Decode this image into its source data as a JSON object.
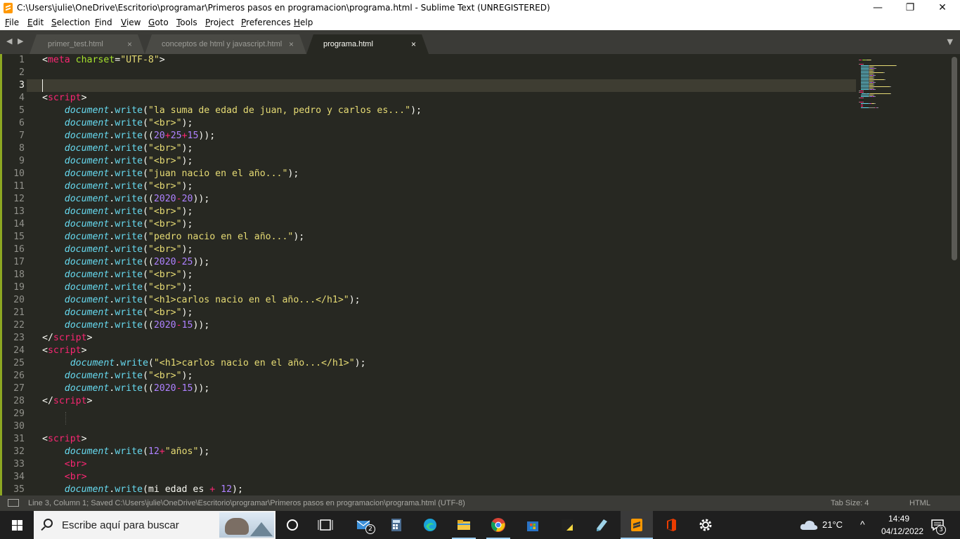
{
  "window": {
    "title": "C:\\Users\\julie\\OneDrive\\Escritorio\\programar\\Primeros pasos en programacion\\programa.html - Sublime Text (UNREGISTERED)",
    "minimize": "—",
    "maximize": "❐",
    "close": "✕"
  },
  "menu": [
    "File",
    "Edit",
    "Selection",
    "Find",
    "View",
    "Goto",
    "Tools",
    "Project",
    "Preferences",
    "Help"
  ],
  "tabs": [
    {
      "label": "primer_test.html",
      "close": "×",
      "active": false
    },
    {
      "label": "conceptos de html y javascript.html",
      "close": "×",
      "active": false
    },
    {
      "label": "programa.html",
      "close": "×",
      "active": true
    }
  ],
  "tabbar": {
    "nav": "◀ ▶",
    "dropdown": "▼"
  },
  "editor": {
    "current_line": 3,
    "lines": [
      [
        [
          "t-punc",
          "<"
        ],
        [
          "t-tag",
          "meta"
        ],
        [
          "t-punc",
          " "
        ],
        [
          "t-attr",
          "charset"
        ],
        [
          "t-punc",
          "="
        ],
        [
          "t-str",
          "\"UTF-8\""
        ],
        [
          "t-punc",
          ">"
        ]
      ],
      [],
      [],
      [
        [
          "t-punc",
          "<"
        ],
        [
          "t-tag",
          "script"
        ],
        [
          "t-punc",
          ">"
        ]
      ],
      [
        [
          "t-punc",
          "    "
        ],
        [
          "t-obj",
          "document"
        ],
        [
          "t-punc",
          "."
        ],
        [
          "t-fn",
          "write"
        ],
        [
          "t-punc",
          "("
        ],
        [
          "t-str",
          "\"la suma de edad de juan, pedro y carlos es...\""
        ],
        [
          "t-punc",
          ");"
        ]
      ],
      [
        [
          "t-punc",
          "    "
        ],
        [
          "t-obj",
          "document"
        ],
        [
          "t-punc",
          "."
        ],
        [
          "t-fn",
          "write"
        ],
        [
          "t-punc",
          "("
        ],
        [
          "t-str",
          "\"<br>\""
        ],
        [
          "t-punc",
          ");"
        ]
      ],
      [
        [
          "t-punc",
          "    "
        ],
        [
          "t-obj",
          "document"
        ],
        [
          "t-punc",
          "."
        ],
        [
          "t-fn",
          "write"
        ],
        [
          "t-punc",
          "(("
        ],
        [
          "t-num",
          "20"
        ],
        [
          "t-op",
          "+"
        ],
        [
          "t-num",
          "25"
        ],
        [
          "t-op",
          "+"
        ],
        [
          "t-num",
          "15"
        ],
        [
          "t-punc",
          "));"
        ]
      ],
      [
        [
          "t-punc",
          "    "
        ],
        [
          "t-obj",
          "document"
        ],
        [
          "t-punc",
          "."
        ],
        [
          "t-fn",
          "write"
        ],
        [
          "t-punc",
          "("
        ],
        [
          "t-str",
          "\"<br>\""
        ],
        [
          "t-punc",
          ");"
        ]
      ],
      [
        [
          "t-punc",
          "    "
        ],
        [
          "t-obj",
          "document"
        ],
        [
          "t-punc",
          "."
        ],
        [
          "t-fn",
          "write"
        ],
        [
          "t-punc",
          "("
        ],
        [
          "t-str",
          "\"<br>\""
        ],
        [
          "t-punc",
          ");"
        ]
      ],
      [
        [
          "t-punc",
          "    "
        ],
        [
          "t-obj",
          "document"
        ],
        [
          "t-punc",
          "."
        ],
        [
          "t-fn",
          "write"
        ],
        [
          "t-punc",
          "("
        ],
        [
          "t-str",
          "\"juan nacio en el año...\""
        ],
        [
          "t-punc",
          ");"
        ]
      ],
      [
        [
          "t-punc",
          "    "
        ],
        [
          "t-obj",
          "document"
        ],
        [
          "t-punc",
          "."
        ],
        [
          "t-fn",
          "write"
        ],
        [
          "t-punc",
          "("
        ],
        [
          "t-str",
          "\"<br>\""
        ],
        [
          "t-punc",
          ");"
        ]
      ],
      [
        [
          "t-punc",
          "    "
        ],
        [
          "t-obj",
          "document"
        ],
        [
          "t-punc",
          "."
        ],
        [
          "t-fn",
          "write"
        ],
        [
          "t-punc",
          "(("
        ],
        [
          "t-num",
          "2020"
        ],
        [
          "t-op",
          "-"
        ],
        [
          "t-num",
          "20"
        ],
        [
          "t-punc",
          "));"
        ]
      ],
      [
        [
          "t-punc",
          "    "
        ],
        [
          "t-obj",
          "document"
        ],
        [
          "t-punc",
          "."
        ],
        [
          "t-fn",
          "write"
        ],
        [
          "t-punc",
          "("
        ],
        [
          "t-str",
          "\"<br>\""
        ],
        [
          "t-punc",
          ");"
        ]
      ],
      [
        [
          "t-punc",
          "    "
        ],
        [
          "t-obj",
          "document"
        ],
        [
          "t-punc",
          "."
        ],
        [
          "t-fn",
          "write"
        ],
        [
          "t-punc",
          "("
        ],
        [
          "t-str",
          "\"<br>\""
        ],
        [
          "t-punc",
          ");"
        ]
      ],
      [
        [
          "t-punc",
          "    "
        ],
        [
          "t-obj",
          "document"
        ],
        [
          "t-punc",
          "."
        ],
        [
          "t-fn",
          "write"
        ],
        [
          "t-punc",
          "("
        ],
        [
          "t-str",
          "\"pedro nacio en el año...\""
        ],
        [
          "t-punc",
          ");"
        ]
      ],
      [
        [
          "t-punc",
          "    "
        ],
        [
          "t-obj",
          "document"
        ],
        [
          "t-punc",
          "."
        ],
        [
          "t-fn",
          "write"
        ],
        [
          "t-punc",
          "("
        ],
        [
          "t-str",
          "\"<br>\""
        ],
        [
          "t-punc",
          ");"
        ]
      ],
      [
        [
          "t-punc",
          "    "
        ],
        [
          "t-obj",
          "document"
        ],
        [
          "t-punc",
          "."
        ],
        [
          "t-fn",
          "write"
        ],
        [
          "t-punc",
          "(("
        ],
        [
          "t-num",
          "2020"
        ],
        [
          "t-op",
          "-"
        ],
        [
          "t-num",
          "25"
        ],
        [
          "t-punc",
          "));"
        ]
      ],
      [
        [
          "t-punc",
          "    "
        ],
        [
          "t-obj",
          "document"
        ],
        [
          "t-punc",
          "."
        ],
        [
          "t-fn",
          "write"
        ],
        [
          "t-punc",
          "("
        ],
        [
          "t-str",
          "\"<br>\""
        ],
        [
          "t-punc",
          ");"
        ]
      ],
      [
        [
          "t-punc",
          "    "
        ],
        [
          "t-obj",
          "document"
        ],
        [
          "t-punc",
          "."
        ],
        [
          "t-fn",
          "write"
        ],
        [
          "t-punc",
          "("
        ],
        [
          "t-str",
          "\"<br>\""
        ],
        [
          "t-punc",
          ");"
        ]
      ],
      [
        [
          "t-punc",
          "    "
        ],
        [
          "t-obj",
          "document"
        ],
        [
          "t-punc",
          "."
        ],
        [
          "t-fn",
          "write"
        ],
        [
          "t-punc",
          "("
        ],
        [
          "t-str",
          "\"<h1>carlos nacio en el año...</h1>\""
        ],
        [
          "t-punc",
          ");"
        ]
      ],
      [
        [
          "t-punc",
          "    "
        ],
        [
          "t-obj",
          "document"
        ],
        [
          "t-punc",
          "."
        ],
        [
          "t-fn",
          "write"
        ],
        [
          "t-punc",
          "("
        ],
        [
          "t-str",
          "\"<br>\""
        ],
        [
          "t-punc",
          ");"
        ]
      ],
      [
        [
          "t-punc",
          "    "
        ],
        [
          "t-obj",
          "document"
        ],
        [
          "t-punc",
          "."
        ],
        [
          "t-fn",
          "write"
        ],
        [
          "t-punc",
          "(("
        ],
        [
          "t-num",
          "2020"
        ],
        [
          "t-op",
          "-"
        ],
        [
          "t-num",
          "15"
        ],
        [
          "t-punc",
          "));"
        ]
      ],
      [
        [
          "t-punc",
          "</"
        ],
        [
          "t-tag",
          "script"
        ],
        [
          "t-punc",
          ">"
        ]
      ],
      [
        [
          "t-punc",
          "<"
        ],
        [
          "t-tag",
          "script"
        ],
        [
          "t-punc",
          ">"
        ]
      ],
      [
        [
          "t-punc",
          "     "
        ],
        [
          "t-obj",
          "document"
        ],
        [
          "t-punc",
          "."
        ],
        [
          "t-fn",
          "write"
        ],
        [
          "t-punc",
          "("
        ],
        [
          "t-str",
          "\"<h1>carlos nacio en el año...</h1>\""
        ],
        [
          "t-punc",
          ");"
        ]
      ],
      [
        [
          "t-punc",
          "    "
        ],
        [
          "t-obj",
          "document"
        ],
        [
          "t-punc",
          "."
        ],
        [
          "t-fn",
          "write"
        ],
        [
          "t-punc",
          "("
        ],
        [
          "t-str",
          "\"<br>\""
        ],
        [
          "t-punc",
          ");"
        ]
      ],
      [
        [
          "t-punc",
          "    "
        ],
        [
          "t-obj",
          "document"
        ],
        [
          "t-punc",
          "."
        ],
        [
          "t-fn",
          "write"
        ],
        [
          "t-punc",
          "(("
        ],
        [
          "t-num",
          "2020"
        ],
        [
          "t-op",
          "-"
        ],
        [
          "t-num",
          "15"
        ],
        [
          "t-punc",
          "));"
        ]
      ],
      [
        [
          "t-punc",
          "</"
        ],
        [
          "t-tag",
          "script"
        ],
        [
          "t-punc",
          ">"
        ]
      ],
      [],
      [],
      [
        [
          "t-punc",
          "<"
        ],
        [
          "t-tag",
          "script"
        ],
        [
          "t-punc",
          ">"
        ]
      ],
      [
        [
          "t-punc",
          "    "
        ],
        [
          "t-obj",
          "document"
        ],
        [
          "t-punc",
          "."
        ],
        [
          "t-fn",
          "write"
        ],
        [
          "t-punc",
          "("
        ],
        [
          "t-num",
          "12"
        ],
        [
          "t-op",
          "+"
        ],
        [
          "t-str",
          "\"años\""
        ],
        [
          "t-punc",
          ");"
        ]
      ],
      [
        [
          "t-punc",
          "    "
        ],
        [
          "t-tag",
          "<br>"
        ]
      ],
      [
        [
          "t-punc",
          "    "
        ],
        [
          "t-tag",
          "<br>"
        ]
      ],
      [
        [
          "t-punc",
          "    "
        ],
        [
          "t-obj",
          "document"
        ],
        [
          "t-punc",
          "."
        ],
        [
          "t-fn",
          "write"
        ],
        [
          "t-punc",
          "(mi edad es "
        ],
        [
          "t-op",
          "+"
        ],
        [
          "t-punc",
          " "
        ],
        [
          "t-num",
          "12"
        ],
        [
          "t-punc",
          ");"
        ]
      ]
    ]
  },
  "statusbar": {
    "position": "Line 3, Column 1; Saved C:\\Users\\julie\\OneDrive\\Escritorio\\programar\\Primeros pasos en programacion\\programa.html (UTF-8)",
    "tab_size": "Tab Size: 4",
    "syntax": "HTML"
  },
  "taskbar": {
    "search_placeholder": "Escribe aquí para buscar",
    "apps": [
      {
        "name": "cortana-icon",
        "badge": ""
      },
      {
        "name": "task-view-icon",
        "badge": ""
      },
      {
        "name": "mail-icon",
        "badge": "2"
      },
      {
        "name": "calculator-icon",
        "badge": ""
      },
      {
        "name": "edge-icon",
        "badge": ""
      },
      {
        "name": "file-explorer-icon",
        "badge": ""
      },
      {
        "name": "chrome-icon",
        "badge": ""
      },
      {
        "name": "store-icon",
        "badge": ""
      },
      {
        "name": "sticky-notes-icon",
        "badge": ""
      },
      {
        "name": "notepad-icon",
        "badge": ""
      },
      {
        "name": "sublime-text-icon",
        "badge": ""
      },
      {
        "name": "office-icon",
        "badge": ""
      },
      {
        "name": "settings-icon",
        "badge": ""
      }
    ],
    "weather": "21°C",
    "chevron": "^",
    "time": "14:49",
    "date": "04/12/2022",
    "notifications": "3"
  },
  "colors": {
    "editor_bg": "#272822",
    "tag": "#f92672",
    "attr": "#a6e22e",
    "string": "#e6db74",
    "number": "#ae81ff",
    "keyword": "#66d9ef",
    "taskbar": "#1f1f1f"
  }
}
